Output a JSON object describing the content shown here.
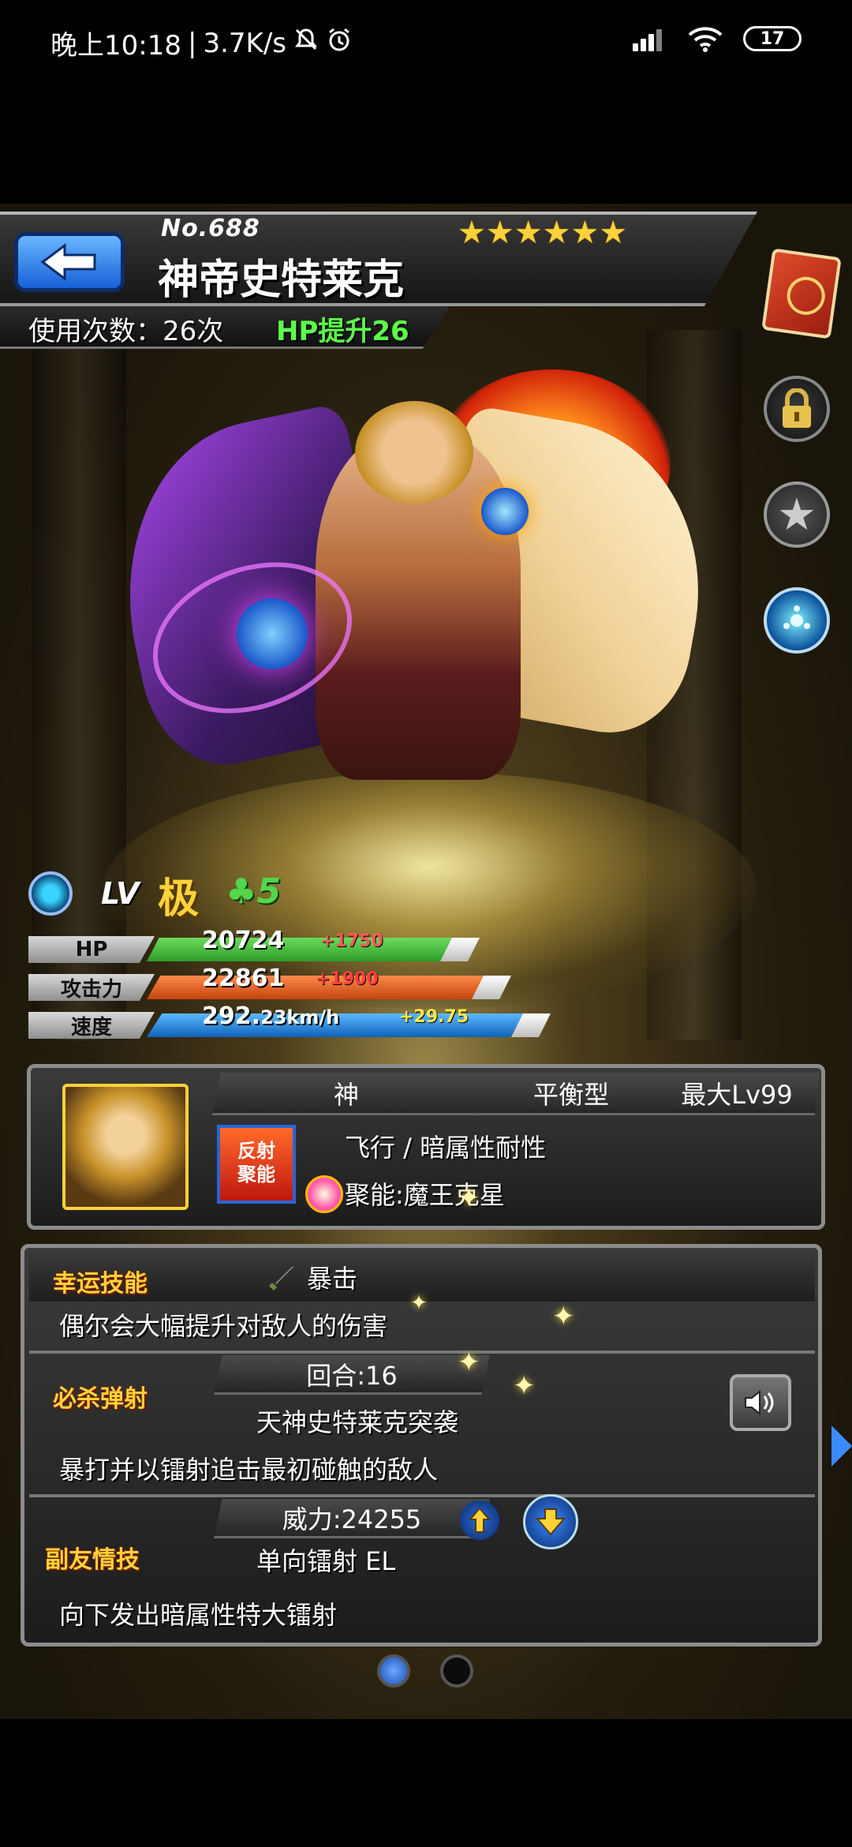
{
  "status_bar": {
    "time": "晚上10:18",
    "network_speed": "3.7K/s",
    "battery": "17"
  },
  "header": {
    "number": "No.688",
    "name": "神帝史特莱克",
    "rarity_stars": "★★★★★★",
    "use_count": "使用次数：26次",
    "hp_boost": "HP提升26"
  },
  "level": {
    "lv_label": "LV",
    "lv_value": "极",
    "luck": "♣5"
  },
  "stats": {
    "hp": {
      "label": "HP",
      "value": "20724",
      "bonus": "+1750",
      "color": "#3fbf3a"
    },
    "attack": {
      "label": "攻击力",
      "value": "22861",
      "bonus": "+1900",
      "color": "#e8641e"
    },
    "speed": {
      "label": "速度",
      "value": "292.",
      "value_small": "23km/h",
      "bonus": "+29.75",
      "color": "#1e8fe0"
    }
  },
  "profile": {
    "tribe": "神",
    "type": "平衡型",
    "max_level": "最大Lv99",
    "abilities": "飞行 / 暗属性耐性",
    "badge_line1": "反射",
    "badge_line2": "聚能",
    "gauge": "聚能:魔王克星"
  },
  "luck_skill": {
    "tag": "幸运技能",
    "name": "暴击",
    "description": "偶尔会大幅提升对敌人的伤害"
  },
  "strike_shot": {
    "tag": "必杀弹射",
    "turns": "回合:16",
    "name": "天神史特莱克突袭",
    "description": "暴打并以镭射追击最初碰触的敌人"
  },
  "friend_combo": {
    "tag": "副友情技",
    "power": "威力:24255",
    "name": "单向镭射 EL",
    "description": "向下发出暗属性特大镭射"
  },
  "pagination": {
    "current": 1,
    "total": 2
  }
}
